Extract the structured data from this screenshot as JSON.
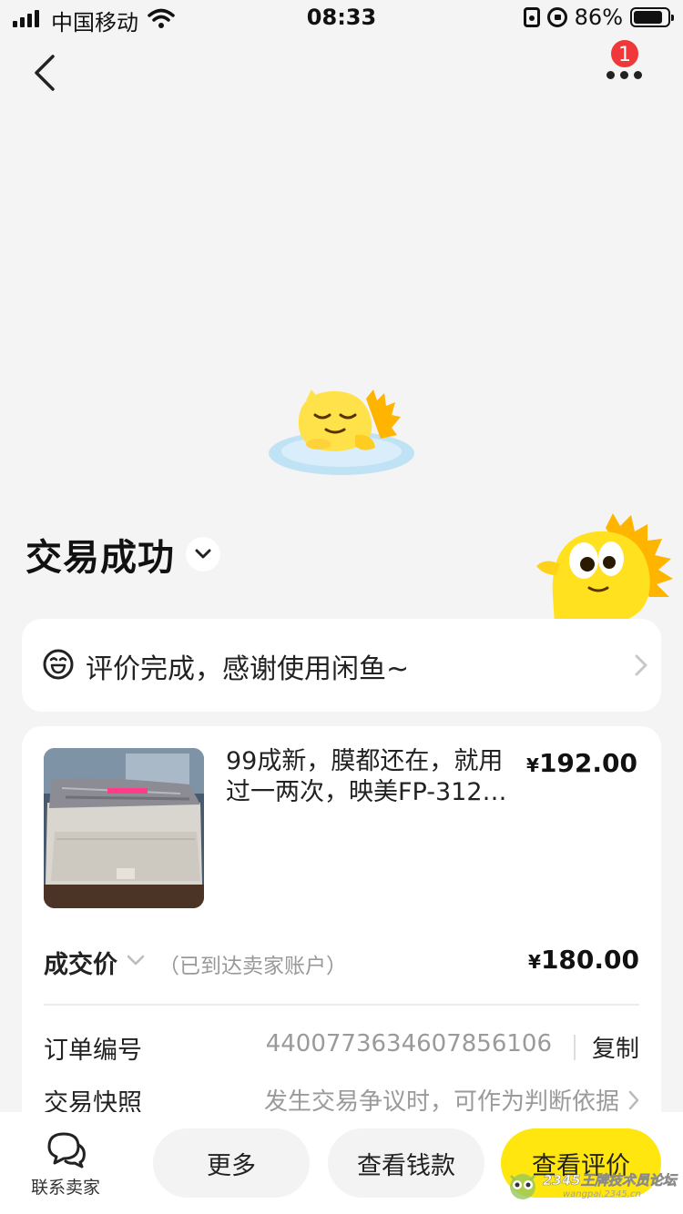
{
  "status_bar": {
    "carrier": "中国移动",
    "time": "08:33",
    "battery_text": "86%",
    "battery_level": 0.86
  },
  "nav": {
    "notification_count": "1"
  },
  "header": {
    "title": "交易成功"
  },
  "review_banner": {
    "text": "评价完成，感谢使用闲鱼~"
  },
  "order": {
    "product_title": "99成新，膜都还在，就用过一两次，映美FP-312…",
    "product_price": "192.00",
    "currency": "¥",
    "deal_label": "成交价",
    "deal_note": "（已到达卖家账户）",
    "deal_price": "180.00",
    "order_number_label": "订单编号",
    "order_number": "4400773634607856106",
    "copy_label": "复制",
    "snapshot_label": "交易快照",
    "snapshot_text": "发生交易争议时，可作为判断依据"
  },
  "bottom_bar": {
    "contact_label": "联系卖家",
    "more_label": "更多",
    "view_money_label": "查看钱款",
    "view_review_label": "查看评价"
  },
  "watermark": {
    "text": "2345王牌技术员论坛",
    "sub": "wangpai.2345.cn"
  },
  "colors": {
    "accent_yellow": "#ffe60f",
    "badge_red": "#f0373a",
    "page_bg": "#f4f4f4",
    "muted_text": "#9a9a9a"
  }
}
